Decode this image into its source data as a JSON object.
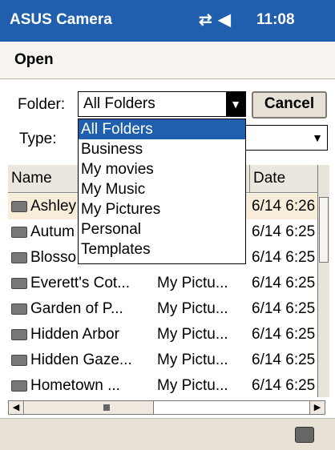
{
  "titlebar": {
    "app_name": "ASUS Camera",
    "status_icons": "⇄ ◀",
    "time": "11:08",
    "accent": "#1f5fae"
  },
  "dialog": {
    "title": "Open",
    "folder_label": "Folder:",
    "folder_value": "All Folders",
    "cancel_label": "Cancel",
    "type_label": "Type:"
  },
  "folder_options": [
    {
      "label": "All Folders"
    },
    {
      "label": "Business"
    },
    {
      "label": "My movies"
    },
    {
      "label": "My Music"
    },
    {
      "label": "My Pictures"
    },
    {
      "label": "Personal"
    },
    {
      "label": "Templates"
    }
  ],
  "table": {
    "columns": {
      "name": "Name",
      "folder": "",
      "date": "Date"
    },
    "rows": [
      {
        "name": "Ashley",
        "folder": "",
        "date": "6/14 6:26"
      },
      {
        "name": "Autum",
        "folder": "",
        "date": "6/14 6:25"
      },
      {
        "name": "Blosso",
        "folder": "",
        "date": "6/14 6:25"
      },
      {
        "name": "Everett's Cot...",
        "folder": "My Pictu...",
        "date": "6/14 6:25"
      },
      {
        "name": "Garden of P...",
        "folder": "My Pictu...",
        "date": "6/14 6:25"
      },
      {
        "name": "Hidden Arbor",
        "folder": "My Pictu...",
        "date": "6/14 6:25"
      },
      {
        "name": "Hidden Gaze...",
        "folder": "My Pictu...",
        "date": "6/14 6:25"
      },
      {
        "name": "Hometown ...",
        "folder": "My Pictu...",
        "date": "6/14 6:25"
      }
    ]
  }
}
